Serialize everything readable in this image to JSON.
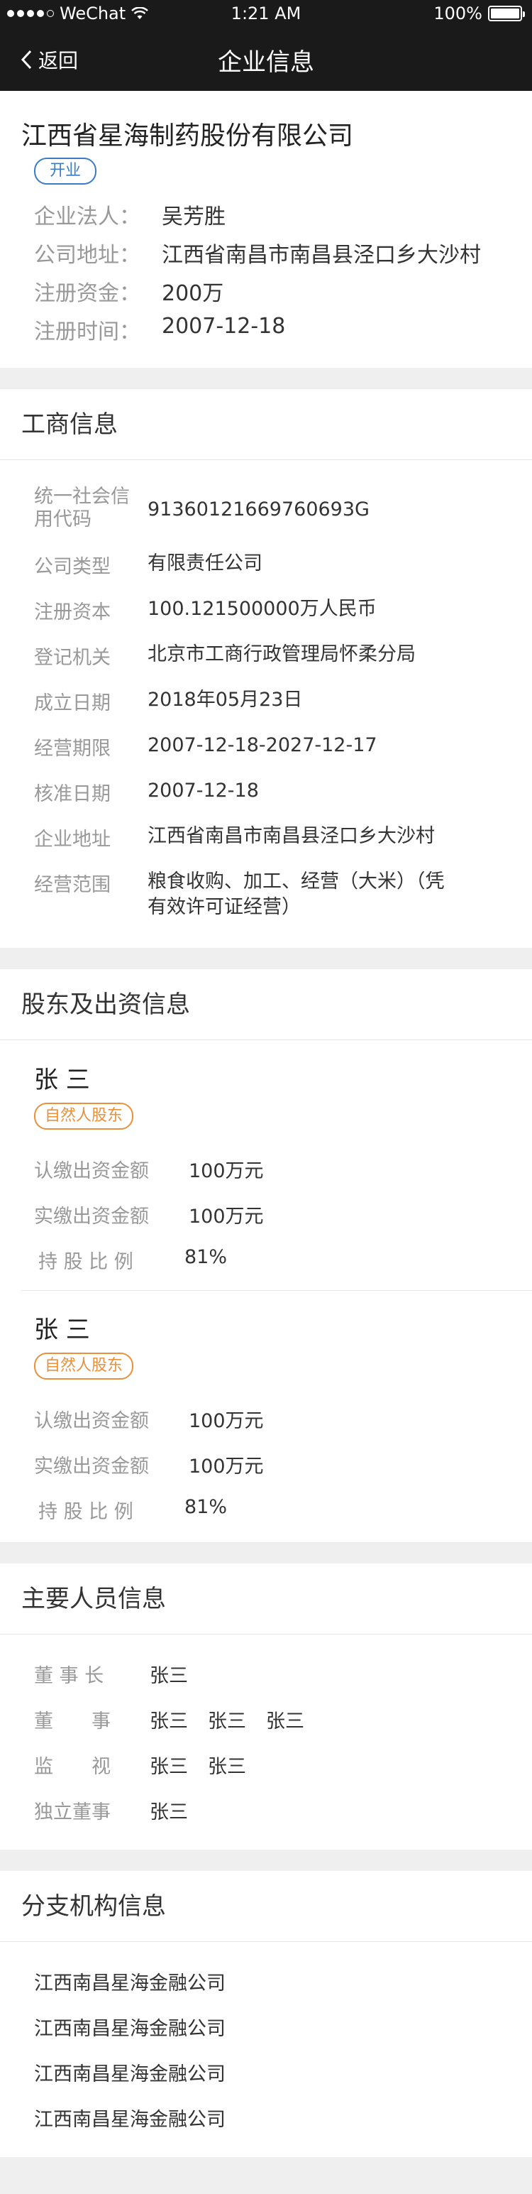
{
  "status_bar": {
    "carrier": "WeChat",
    "time": "1:21 AM",
    "battery": "100%"
  },
  "nav": {
    "back_label": "返回",
    "title": "企业信息"
  },
  "company": {
    "name": "江西省星海制药股份有限公司",
    "status": "开业",
    "fields": [
      {
        "label": "企业法人：",
        "value": "吴芳胜"
      },
      {
        "label": "公司地址：",
        "value": "江西省南昌市南昌县泾口乡大沙村"
      },
      {
        "label": "注册资金：",
        "value": "200万"
      },
      {
        "label": "注册时间：",
        "value": "2007-12-18"
      }
    ]
  },
  "business": {
    "title": "工商信息",
    "rows": [
      {
        "label": "统一社会信用代码",
        "value": "91360121669760693G"
      },
      {
        "label": "公司类型",
        "value": "有限责任公司"
      },
      {
        "label": "注册资本",
        "value": "100.121500000万人民币"
      },
      {
        "label": "登记机关",
        "value": "北京市工商行政管理局怀柔分局"
      },
      {
        "label": "成立日期",
        "value": "2018年05月23日"
      },
      {
        "label": "经营期限",
        "value": "2007-12-18-2027-12-17"
      },
      {
        "label": "核准日期",
        "value": "2007-12-18"
      },
      {
        "label": "企业地址",
        "value": "江西省南昌市南昌县泾口乡大沙村"
      },
      {
        "label": "经营范围",
        "value": "粮食收购、加工、经营（大米）（凭有效许可证经营）"
      }
    ]
  },
  "shareholders": {
    "title": "股东及出资信息",
    "items": [
      {
        "name": "张 三",
        "tag": "自然人股东",
        "rows": [
          {
            "label": "认缴出资金额",
            "value": "100万元"
          },
          {
            "label": "实缴出资金额",
            "value": "100万元"
          },
          {
            "label": "持 股 比 例",
            "value": "81%"
          }
        ]
      },
      {
        "name": "张 三",
        "tag": "自然人股东",
        "rows": [
          {
            "label": "认缴出资金额",
            "value": "100万元"
          },
          {
            "label": "实缴出资金额",
            "value": "100万元"
          },
          {
            "label": "持 股 比 例",
            "value": "81%"
          }
        ]
      }
    ]
  },
  "persons": {
    "title": "主要人员信息",
    "rows": [
      {
        "label": "董 事 长",
        "names": [
          "张三"
        ]
      },
      {
        "label": "董　　事",
        "names": [
          "张三",
          "张三",
          "张三"
        ]
      },
      {
        "label": "监　　视",
        "names": [
          "张三",
          "张三"
        ]
      },
      {
        "label": "独立董事",
        "names": [
          "张三"
        ]
      }
    ]
  },
  "branches": {
    "title": "分支机构信息",
    "items": [
      "江西南昌星海金融公司",
      "江西南昌星海金融公司",
      "江西南昌星海金融公司",
      "江西南昌星海金融公司"
    ]
  }
}
